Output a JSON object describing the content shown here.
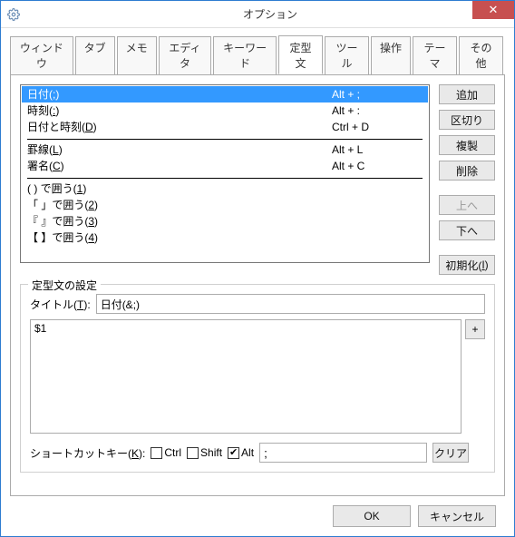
{
  "window": {
    "title": "オプション",
    "close_icon": "✕"
  },
  "tabs": [
    {
      "label": "ウィンドウ"
    },
    {
      "label": "タブ"
    },
    {
      "label": "メモ"
    },
    {
      "label": "エディタ"
    },
    {
      "label": "キーワード"
    },
    {
      "label": "定型文"
    },
    {
      "label": "ツール"
    },
    {
      "label": "操作"
    },
    {
      "label": "テーマ"
    },
    {
      "label": "その他"
    }
  ],
  "list_items": [
    {
      "nameHtml": "日付(<span class='underline'>;</span>)",
      "shortcut": "Alt + ;",
      "selected": true
    },
    {
      "nameHtml": "時刻(<span class='underline'>:</span>)",
      "shortcut": "Alt + :"
    },
    {
      "nameHtml": "日付と時刻(<span class='underline'>D</span>)",
      "shortcut": "Ctrl + D"
    },
    {
      "separator": true
    },
    {
      "nameHtml": "罫線(<span class='underline'>L</span>)",
      "shortcut": "Alt + L"
    },
    {
      "nameHtml": "署名(<span class='underline'>C</span>)",
      "shortcut": "Alt + C"
    },
    {
      "separator": true
    },
    {
      "nameHtml": "(   ) で囲う(<span class='underline'>1</span>)",
      "shortcut": ""
    },
    {
      "nameHtml": "「  」で囲う(<span class='underline'>2</span>)",
      "shortcut": ""
    },
    {
      "nameHtml": "『  』で囲う(<span class='underline'>3</span>)",
      "shortcut": ""
    },
    {
      "nameHtml": "【  】で囲う(<span class='underline'>4</span>)",
      "shortcut": ""
    }
  ],
  "side_buttons": {
    "add": "追加",
    "separator": "区切り",
    "duplicate": "複製",
    "delete": "削除",
    "up": "上へ",
    "down": "下へ",
    "initHtml": "初期化(<span class='underline'>I</span>)"
  },
  "settings": {
    "group_title": "定型文の設定",
    "title_labelHtml": "タイトル(<span class='underline'>T</span>):",
    "title_value": "日付(&;)",
    "body_value": "$1",
    "plus": "+",
    "shortcut_labelHtml": "ショートカットキー(<span class='underline'>K</span>):",
    "ctrl_label": "Ctrl",
    "shift_label": "Shift",
    "alt_label": "Alt",
    "ctrl_checked": false,
    "shift_checked": false,
    "alt_checked": true,
    "shortcut_key": ";",
    "clear": "クリア"
  },
  "footer": {
    "ok": "OK",
    "cancel": "キャンセル"
  }
}
